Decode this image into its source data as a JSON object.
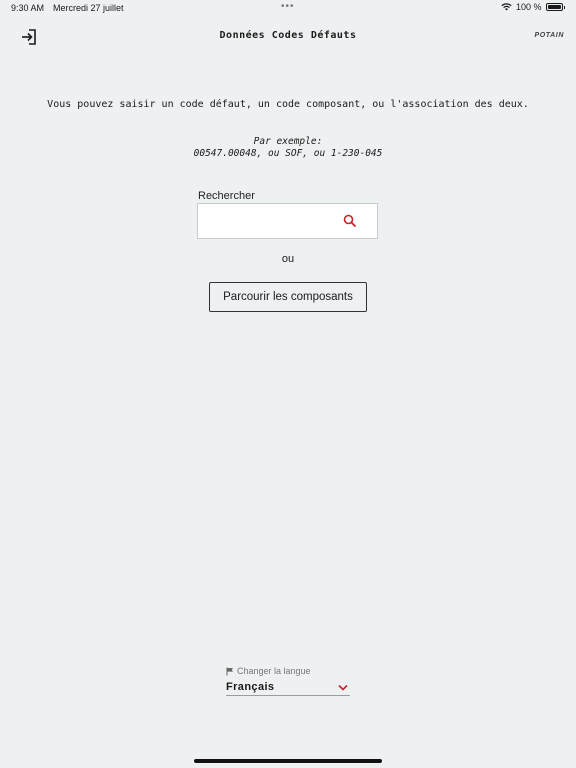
{
  "status_bar": {
    "time": "9:30 AM",
    "date": "Mercredi 27 juillet",
    "battery_text": "100 %",
    "battery_level": 1.0
  },
  "header": {
    "title": "Données Codes Défauts",
    "brand": "POTAIN",
    "exit_icon": "exit-arrow-icon"
  },
  "main": {
    "intro": "Vous pouvez saisir un code défaut, un code composant, ou l'association des deux.",
    "example_label": "Par exemple:",
    "example_values": "00547.00048, ou SOF, ou 1-230-045",
    "search_label": "Rechercher",
    "search_value": "",
    "search_icon": "search-icon",
    "or_text": "ou",
    "browse_label": "Parcourir les composants"
  },
  "language": {
    "label": "Changer la langue",
    "selected": "Français",
    "flag_icon": "flag-icon",
    "chevron_icon": "chevron-down-icon"
  },
  "colors": {
    "background": "#eef1f2",
    "accent": "#c8202f",
    "text": "#1a1a1a"
  }
}
